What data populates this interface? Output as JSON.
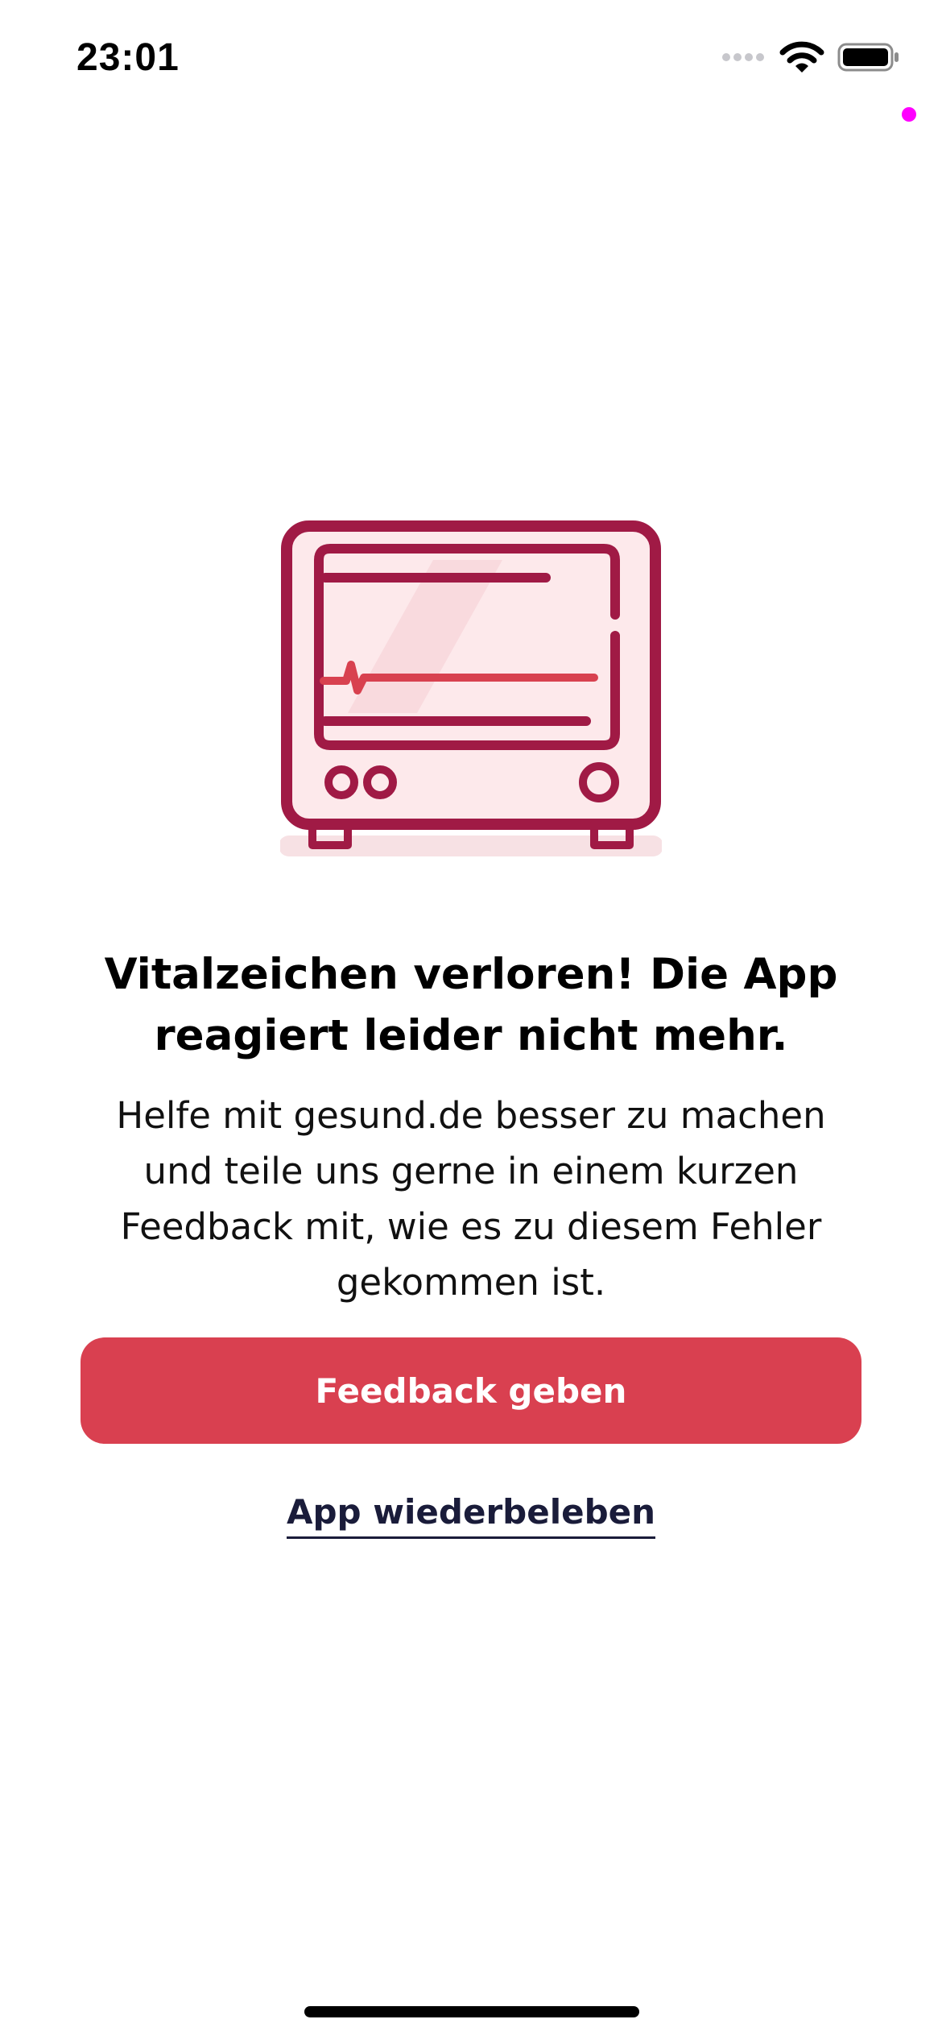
{
  "status_bar": {
    "time": "23:01",
    "icons": [
      "cellular-signal-icon",
      "wifi-icon",
      "battery-icon"
    ]
  },
  "illustration": {
    "name": "vital-monitor-illustration",
    "colors": {
      "outline": "#a01a45",
      "pulse_line": "#d8414f",
      "screen_shade": "#f9e2e5",
      "shadow": "#f7e1e4"
    }
  },
  "error": {
    "title": "Vitalzeichen verloren! Die App reagiert leider nicht mehr.",
    "description": "Helfe mit gesund.de besser zu machen und teile uns gerne in einem kurzen Feedback mit, wie es zu diesem Fehler gekommen ist."
  },
  "actions": {
    "feedback_label": "Feedback geben",
    "revive_label": "App wiederbeleben"
  },
  "colors": {
    "primary_button": "#d94050",
    "link_text": "#1a1c3a",
    "recording_indicator": "#ff00ff"
  }
}
